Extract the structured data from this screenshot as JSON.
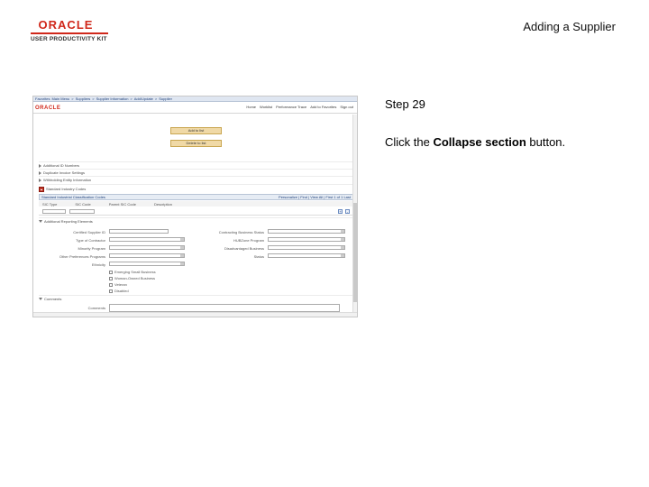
{
  "header": {
    "logo_brand": "ORACLE",
    "logo_product": "USER PRODUCTIVITY KIT",
    "doc_title": "Adding a Supplier"
  },
  "step": {
    "title": "Step 29",
    "text_before": "Click the ",
    "text_bold": "Collapse section",
    "text_after": " button."
  },
  "screenshot": {
    "nav_items": [
      "Favorites",
      "Main Menu",
      ">",
      "Suppliers",
      ">",
      "Supplier Information",
      ">",
      "Add/Update",
      ">",
      "Supplier"
    ],
    "brand": "ORACLE",
    "header_links": [
      "Home",
      "Worklist",
      "Performance Trace",
      "Add to Favorites",
      "Sign out"
    ],
    "buttons": [
      "Add to list",
      "Delete to list"
    ],
    "sections": [
      "Additional ID Numbers",
      "Duplicate Invoice Settings",
      "Withholding Entity Information",
      "Standard Industry Codes",
      "Additional Reporting Elements",
      "Comments"
    ],
    "grid": {
      "title": "Standard Industrial Classification Codes",
      "nav": "Personalize | Find | View All | First 1 of 1 Last",
      "columns": [
        "SIC Type",
        "SIC Code",
        "Parent SIC Code",
        "Description"
      ]
    },
    "fields_left": [
      "Certified Supplier ID",
      "Type of Contractor",
      "Minority Program",
      "Other Preferences Programs",
      "Ethnicity"
    ],
    "fields_right": [
      "Contracting Business Status",
      "HUBZone Program",
      "Disadvantaged Business",
      "Status"
    ],
    "checkboxes": [
      "Emerging Small Business",
      "Woman-Owned Business",
      "Veteran",
      "Disabled"
    ],
    "comments_label": "Comments"
  }
}
